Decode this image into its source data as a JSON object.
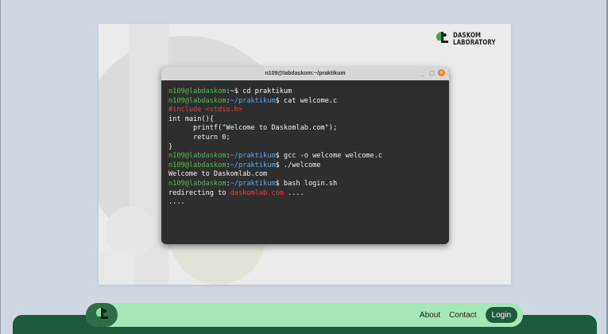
{
  "brand": {
    "name": "DASKOM\nLABORATORY",
    "icon": "daskom-logo-icon"
  },
  "terminal": {
    "title": "n109@labdaskom:~/praktikum",
    "controls": {
      "minimize": "_",
      "maximize": "□",
      "close": "×"
    },
    "lines": [
      [
        {
          "t": "n109@labdaskom",
          "c": "user"
        },
        {
          "t": ":~$ cd praktikum",
          "c": "text"
        }
      ],
      [
        {
          "t": "n109@labdaskom",
          "c": "user"
        },
        {
          "t": ":",
          "c": "text"
        },
        {
          "t": "~/praktikum",
          "c": "path"
        },
        {
          "t": "$ cat welcome.c",
          "c": "text"
        }
      ],
      [
        {
          "t": "#include <stdio.h>",
          "c": "red"
        }
      ],
      [
        {
          "t": "int main(){",
          "c": "text"
        }
      ],
      [
        {
          "t": "      printf(\"Welcome to Daskomlab.com\");",
          "c": "text"
        }
      ],
      [
        {
          "t": "      return 0;",
          "c": "text"
        }
      ],
      [
        {
          "t": "}",
          "c": "text"
        }
      ],
      [
        {
          "t": "n109@labdaskom",
          "c": "user"
        },
        {
          "t": ":",
          "c": "text"
        },
        {
          "t": "~/praktikum",
          "c": "path"
        },
        {
          "t": "$ gcc -o welcome welcome.c",
          "c": "text"
        }
      ],
      [
        {
          "t": "n109@labdaskom",
          "c": "user"
        },
        {
          "t": ":",
          "c": "text"
        },
        {
          "t": "~/praktikum",
          "c": "path"
        },
        {
          "t": "$ ./welcome",
          "c": "text"
        }
      ],
      [
        {
          "t": "Welcome to Daskomlab.com",
          "c": "text"
        }
      ],
      [
        {
          "t": "n109@labdaskom",
          "c": "user"
        },
        {
          "t": ":",
          "c": "text"
        },
        {
          "t": "~/praktikum",
          "c": "path"
        },
        {
          "t": "$ bash login.sh",
          "c": "text"
        }
      ],
      [
        {
          "t": "redirecting to ",
          "c": "text"
        },
        {
          "t": "daskomlab.com",
          "c": "red"
        },
        {
          "t": " ....",
          "c": "text"
        }
      ],
      [
        {
          "t": "....",
          "c": "text"
        }
      ]
    ]
  },
  "nav": {
    "logo_icon": "daskom-logo-icon",
    "about": "About",
    "contact": "Contact",
    "login": "Login"
  },
  "colors": {
    "page_bg": "#cfd8e2",
    "card_bg": "#ebebeb",
    "terminal_bg": "#2e2e2e",
    "prompt_user": "#47c248",
    "prompt_path": "#5aa5e8",
    "highlight_red": "#e6413a",
    "nav_bg": "#a6e8b5",
    "brand_dark_green": "#1e5a3e"
  }
}
